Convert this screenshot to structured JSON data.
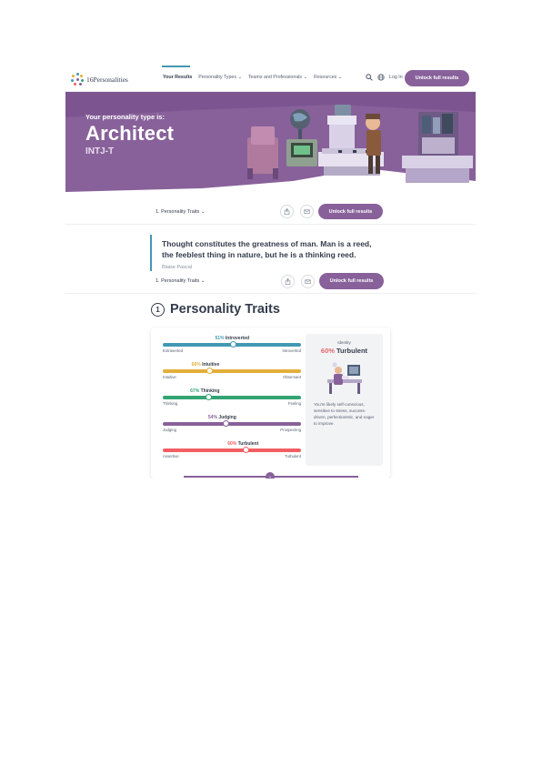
{
  "header": {
    "logo_text": "16Personalities",
    "nav": [
      "Your Results",
      "Personality Types ⌄",
      "Teams and Professionals ⌄",
      "Resources ⌄"
    ],
    "login": "Log In",
    "cta": "Unlock full results"
  },
  "banner": {
    "subtitle": "Your personality type is:",
    "title": "Architect",
    "code": "INTJ-T"
  },
  "subnav": {
    "label": "1. Personality Traits ⌄",
    "cta": "Unlock full results"
  },
  "quote": {
    "text": "Thought constitutes the greatness of man. Man is a reed, the feeblest thing in nature, but he is a thinking reed.",
    "author": "Blaise Pascal"
  },
  "section": {
    "number": "1",
    "title": "Personality Traits"
  },
  "traits": [
    {
      "pct": "51%",
      "name": "Introverted",
      "left": "Extraverted",
      "right": "Introverted",
      "color": "#4298b4",
      "pct_color": "#4298b4",
      "level": 0.51,
      "side": "right"
    },
    {
      "pct": "66%",
      "name": "Intuitive",
      "left": "Intuitive",
      "right": "Observant",
      "color": "#e4ae3a",
      "pct_color": "#e4ae3a",
      "level": 0.66,
      "side": "left"
    },
    {
      "pct": "67%",
      "name": "Thinking",
      "left": "Thinking",
      "right": "Feeling",
      "color": "#33a474",
      "pct_color": "#33a474",
      "level": 0.67,
      "side": "left"
    },
    {
      "pct": "54%",
      "name": "Judging",
      "left": "Judging",
      "right": "Prospecting",
      "color": "#88619a",
      "pct_color": "#88619a",
      "level": 0.54,
      "side": "left"
    },
    {
      "pct": "60%",
      "name": "Turbulent",
      "left": "Assertive",
      "right": "Turbulent",
      "color": "#f25e62",
      "pct_color": "#f25e62",
      "level": 0.6,
      "side": "right"
    }
  ],
  "sidebar": {
    "label": "Identity",
    "pct": "60%",
    "value": "Turbulent",
    "description": "You're likely self-conscious, sensitive to stress, success-driven, perfectionistic, and eager to improve."
  },
  "colors": {
    "accent": "#88619a",
    "banner_bg": "#88619a",
    "text": "#343c4b"
  }
}
